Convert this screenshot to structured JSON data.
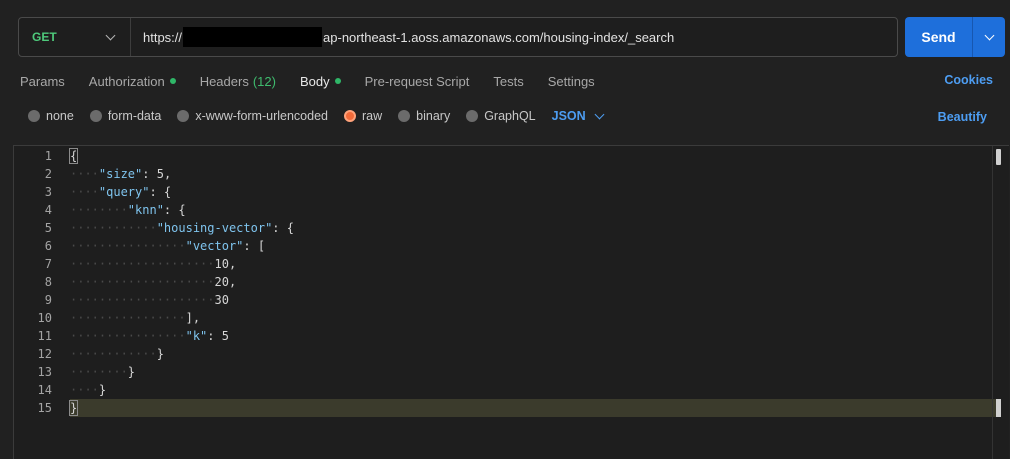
{
  "request": {
    "method": "GET",
    "url_prefix": "https://",
    "url_suffix": "ap-northeast-1.aoss.amazonaws.com/housing-index/_search",
    "send_label": "Send"
  },
  "tabs": [
    {
      "label": "Params",
      "dot": false
    },
    {
      "label": "Authorization",
      "dot": true
    },
    {
      "label": "Headers",
      "count": "(12)"
    },
    {
      "label": "Body",
      "dot": true,
      "active": true
    },
    {
      "label": "Pre-request Script"
    },
    {
      "label": "Tests"
    },
    {
      "label": "Settings"
    }
  ],
  "cookies_label": "Cookies",
  "body_types": [
    {
      "label": "none",
      "selected": false
    },
    {
      "label": "form-data",
      "selected": false
    },
    {
      "label": "x-www-form-urlencoded",
      "selected": false
    },
    {
      "label": "raw",
      "selected": true
    },
    {
      "label": "binary",
      "selected": false
    },
    {
      "label": "GraphQL",
      "selected": false
    }
  ],
  "format_label": "JSON",
  "beautify_label": "Beautify",
  "editor": {
    "line_numbers": [
      "1",
      "2",
      "3",
      "4",
      "5",
      "6",
      "7",
      "8",
      "9",
      "10",
      "11",
      "12",
      "13",
      "14",
      "15"
    ],
    "lines": [
      "{",
      "    \"size\": 5,",
      "    \"query\": {",
      "        \"knn\": {",
      "            \"housing-vector\": {",
      "                \"vector\": [",
      "                    10,",
      "                    20,",
      "                    30",
      "                ],",
      "                \"k\": 5",
      "            }",
      "        }",
      "    }",
      "}"
    ]
  },
  "colors": {
    "accent": "#1e6fdb",
    "link": "#4d9df2",
    "method": "#4ec97b",
    "key": "#7fc4ee",
    "radio_selected": "#f26b3a"
  }
}
